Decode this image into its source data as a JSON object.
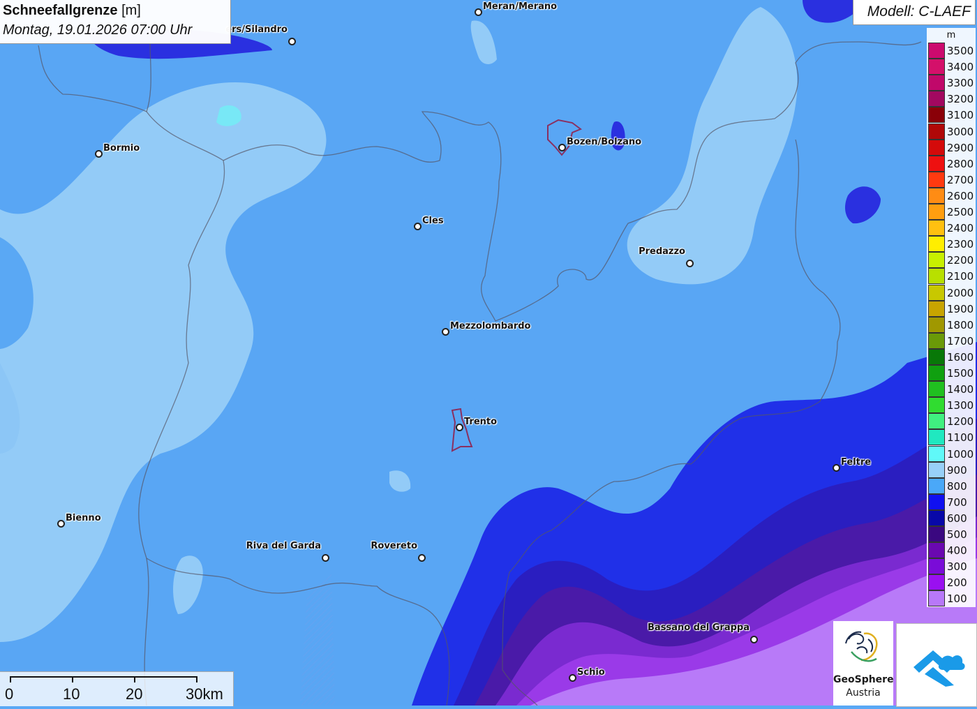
{
  "header": {
    "title": "Schneefallgrenze",
    "unit": "[m]",
    "datetime": "Montag, 19.01.2026 07:00 Uhr"
  },
  "model": {
    "label": "Modell: C-LAEF"
  },
  "legend": {
    "unit": "m",
    "items": [
      {
        "label": "3500",
        "color": "#cc0a6e"
      },
      {
        "label": "3400",
        "color": "#d4106a"
      },
      {
        "label": "3300",
        "color": "#c0086a"
      },
      {
        "label": "3200",
        "color": "#a20860"
      },
      {
        "label": "3100",
        "color": "#8a0008"
      },
      {
        "label": "3000",
        "color": "#b00808"
      },
      {
        "label": "2900",
        "color": "#d40a0a"
      },
      {
        "label": "2800",
        "color": "#ee1010"
      },
      {
        "label": "2700",
        "color": "#ff3a10"
      },
      {
        "label": "2600",
        "color": "#ff8c14"
      },
      {
        "label": "2500",
        "color": "#ff9e10"
      },
      {
        "label": "2400",
        "color": "#ffc010"
      },
      {
        "label": "2300",
        "color": "#ffee00"
      },
      {
        "label": "2200",
        "color": "#c8f000"
      },
      {
        "label": "2100",
        "color": "#b8e000"
      },
      {
        "label": "2000",
        "color": "#c8c800"
      },
      {
        "label": "1900",
        "color": "#c8a400"
      },
      {
        "label": "1800",
        "color": "#a09800"
      },
      {
        "label": "1700",
        "color": "#6a9a08"
      },
      {
        "label": "1600",
        "color": "#087808"
      },
      {
        "label": "1500",
        "color": "#10a010"
      },
      {
        "label": "1400",
        "color": "#20c020"
      },
      {
        "label": "1300",
        "color": "#30dc30"
      },
      {
        "label": "1200",
        "color": "#40f080"
      },
      {
        "label": "1100",
        "color": "#20e8c0"
      },
      {
        "label": "1000",
        "color": "#60f8f8"
      },
      {
        "label": "900",
        "color": "#98d0f8"
      },
      {
        "label": "800",
        "color": "#4aa8f8"
      },
      {
        "label": "700",
        "color": "#1010f0"
      },
      {
        "label": "600",
        "color": "#0808a8"
      },
      {
        "label": "500",
        "color": "#3a0880"
      },
      {
        "label": "400",
        "color": "#6a08b0"
      },
      {
        "label": "300",
        "color": "#7a0cd8"
      },
      {
        "label": "200",
        "color": "#9a10f0"
      },
      {
        "label": "100",
        "color": "#b878f8"
      }
    ]
  },
  "cities": [
    {
      "name": "Meran/Merano",
      "side": "right"
    },
    {
      "name": "ers/Silandro",
      "side": "left"
    },
    {
      "name": "Bormio",
      "side": "right"
    },
    {
      "name": "Bozen/Bolzano",
      "side": "right"
    },
    {
      "name": "Cles",
      "side": "right"
    },
    {
      "name": "Predazzo",
      "side": "left"
    },
    {
      "name": "Mezzolombardo",
      "side": "right"
    },
    {
      "name": "Trento",
      "side": "right"
    },
    {
      "name": "Feltre",
      "side": "right"
    },
    {
      "name": "Bienno",
      "side": "right"
    },
    {
      "name": "Riva del Garda",
      "side": "left"
    },
    {
      "name": "Rovereto",
      "side": "left"
    },
    {
      "name": "Bassano del Grappa",
      "side": "left"
    },
    {
      "name": "Schio",
      "side": "right"
    }
  ],
  "scale": {
    "labels": [
      "0",
      "10",
      "20",
      "30km"
    ]
  },
  "logo": {
    "line1": "GeoSphere",
    "line2": "Austria"
  }
}
